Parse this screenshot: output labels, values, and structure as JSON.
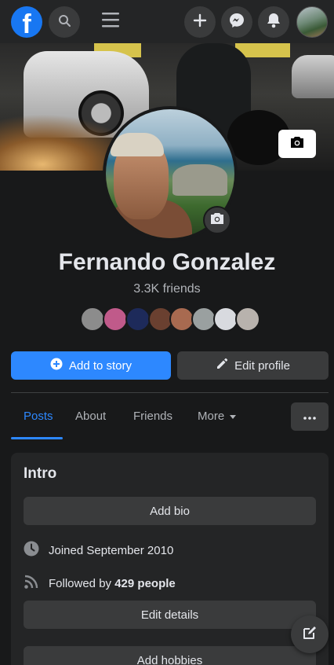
{
  "topbar": {
    "logo": "f",
    "icons": [
      "search-icon",
      "menu-icon",
      "plus-icon",
      "messenger-icon",
      "notifications-icon"
    ]
  },
  "profile": {
    "name": "Fernando Gonzalez",
    "friends_count": "3.3K friends",
    "friend_avatar_colors": [
      "#8c8c8c",
      "#c05a8a",
      "#1d2a5a",
      "#6a4030",
      "#a86a50",
      "#9aa0a0",
      "#d8dadf",
      "#b8b2ad"
    ]
  },
  "actions": {
    "add_story": "Add to story",
    "edit_profile": "Edit profile"
  },
  "tabs": [
    {
      "label": "Posts",
      "active": true
    },
    {
      "label": "About",
      "active": false
    },
    {
      "label": "Friends",
      "active": false
    },
    {
      "label": "More",
      "active": false
    }
  ],
  "intro": {
    "title": "Intro",
    "add_bio": "Add bio",
    "joined": "Joined September 2010",
    "followed_prefix": "Followed by ",
    "followed_count": "429 people",
    "edit_details": "Edit details",
    "add_hobbies": "Add hobbies"
  },
  "colors": {
    "accent": "#2d88ff",
    "background": "#18191a",
    "surface": "#242526",
    "button": "#3a3b3c"
  }
}
